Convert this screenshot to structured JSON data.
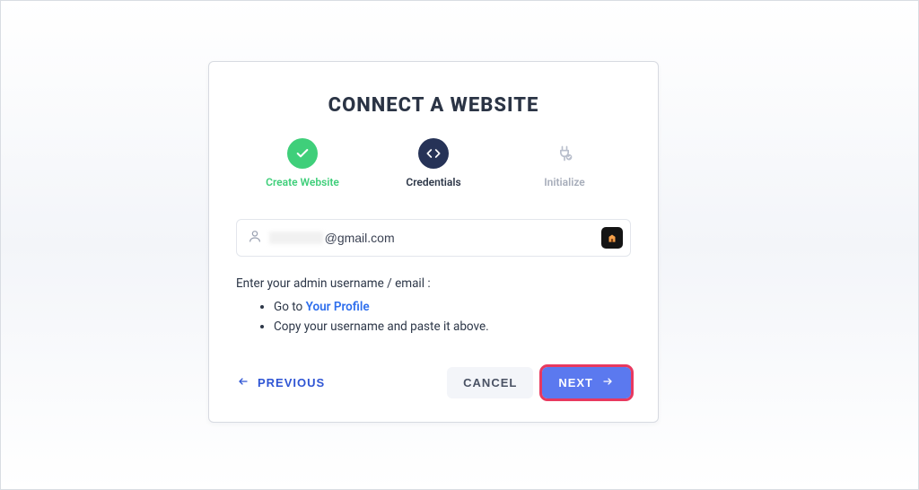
{
  "modal": {
    "title": "CONNECT A WEBSITE",
    "steps": [
      {
        "label": "Create Website",
        "state": "done"
      },
      {
        "label": "Credentials",
        "state": "active"
      },
      {
        "label": "Initialize",
        "state": "pending"
      }
    ],
    "email_input": {
      "value_suffix": "@gmail.com",
      "placeholder": ""
    },
    "instructions_label": "Enter your admin username / email :",
    "bullets": {
      "goto_prefix": "Go to ",
      "profile_link": "Your Profile",
      "copy_line": "Copy your username and paste it above."
    },
    "buttons": {
      "previous": "PREVIOUS",
      "cancel": "CANCEL",
      "next": "NEXT"
    }
  }
}
